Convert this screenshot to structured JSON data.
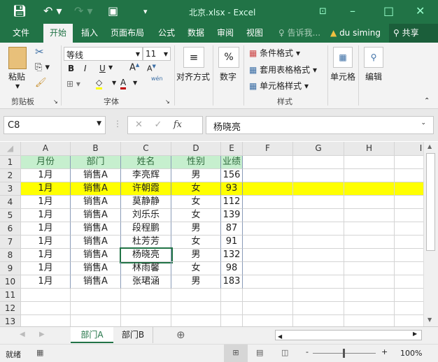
{
  "title": "北京.xlsx - Excel",
  "tabs": [
    "文件",
    "开始",
    "插入",
    "页面布局",
    "公式",
    "数据",
    "审阅",
    "视图"
  ],
  "tell_me": "告诉我...",
  "user": "du siming",
  "share": "共享",
  "ribbon": {
    "paste": "粘贴",
    "clipboard": "剪贴板",
    "font_name": "等线",
    "font_size": "11",
    "bold": "B",
    "italic": "I",
    "underline": "U",
    "font_group": "字体",
    "wen": "wén",
    "align": "对齐方式",
    "number": "数字",
    "percent": "%",
    "cond_format": "条件格式",
    "table_format": "套用表格格式",
    "cell_style": "单元格样式",
    "styles_group": "样式",
    "cells": "单元格",
    "edit": "编辑"
  },
  "formula": {
    "name_box": "C8",
    "fx": "fx",
    "value": "杨晓亮"
  },
  "columns": [
    "A",
    "B",
    "C",
    "D",
    "E",
    "F",
    "G",
    "H",
    "I"
  ],
  "rows": [
    [
      "月份",
      "部门",
      "姓名",
      "性别",
      "业绩"
    ],
    [
      "1月",
      "销售A",
      "李亮辉",
      "男",
      "156"
    ],
    [
      "1月",
      "销售A",
      "许朝霞",
      "女",
      "93"
    ],
    [
      "1月",
      "销售A",
      "莫静静",
      "女",
      "112"
    ],
    [
      "1月",
      "销售A",
      "刘乐乐",
      "女",
      "139"
    ],
    [
      "1月",
      "销售A",
      "段程鹏",
      "男",
      "87"
    ],
    [
      "1月",
      "销售A",
      "杜芳芳",
      "女",
      "91"
    ],
    [
      "1月",
      "销售A",
      "杨晓亮",
      "男",
      "132"
    ],
    [
      "1月",
      "销售A",
      "林雨馨",
      "女",
      "98"
    ],
    [
      "1月",
      "销售A",
      "张珺涵",
      "男",
      "183"
    ],
    [
      "",
      "",
      "",
      "",
      ""
    ],
    [
      "",
      "",
      "",
      "",
      ""
    ],
    [
      "",
      "",
      "",
      "",
      ""
    ]
  ],
  "highlight_row": 3,
  "colors": {
    "brand": "#217346",
    "header_fill": "#c6efce",
    "highlight": "#ffff00"
  },
  "sheets": [
    "部门A",
    "部门B"
  ],
  "status": {
    "ready": "就绪",
    "zoom": "100%"
  }
}
